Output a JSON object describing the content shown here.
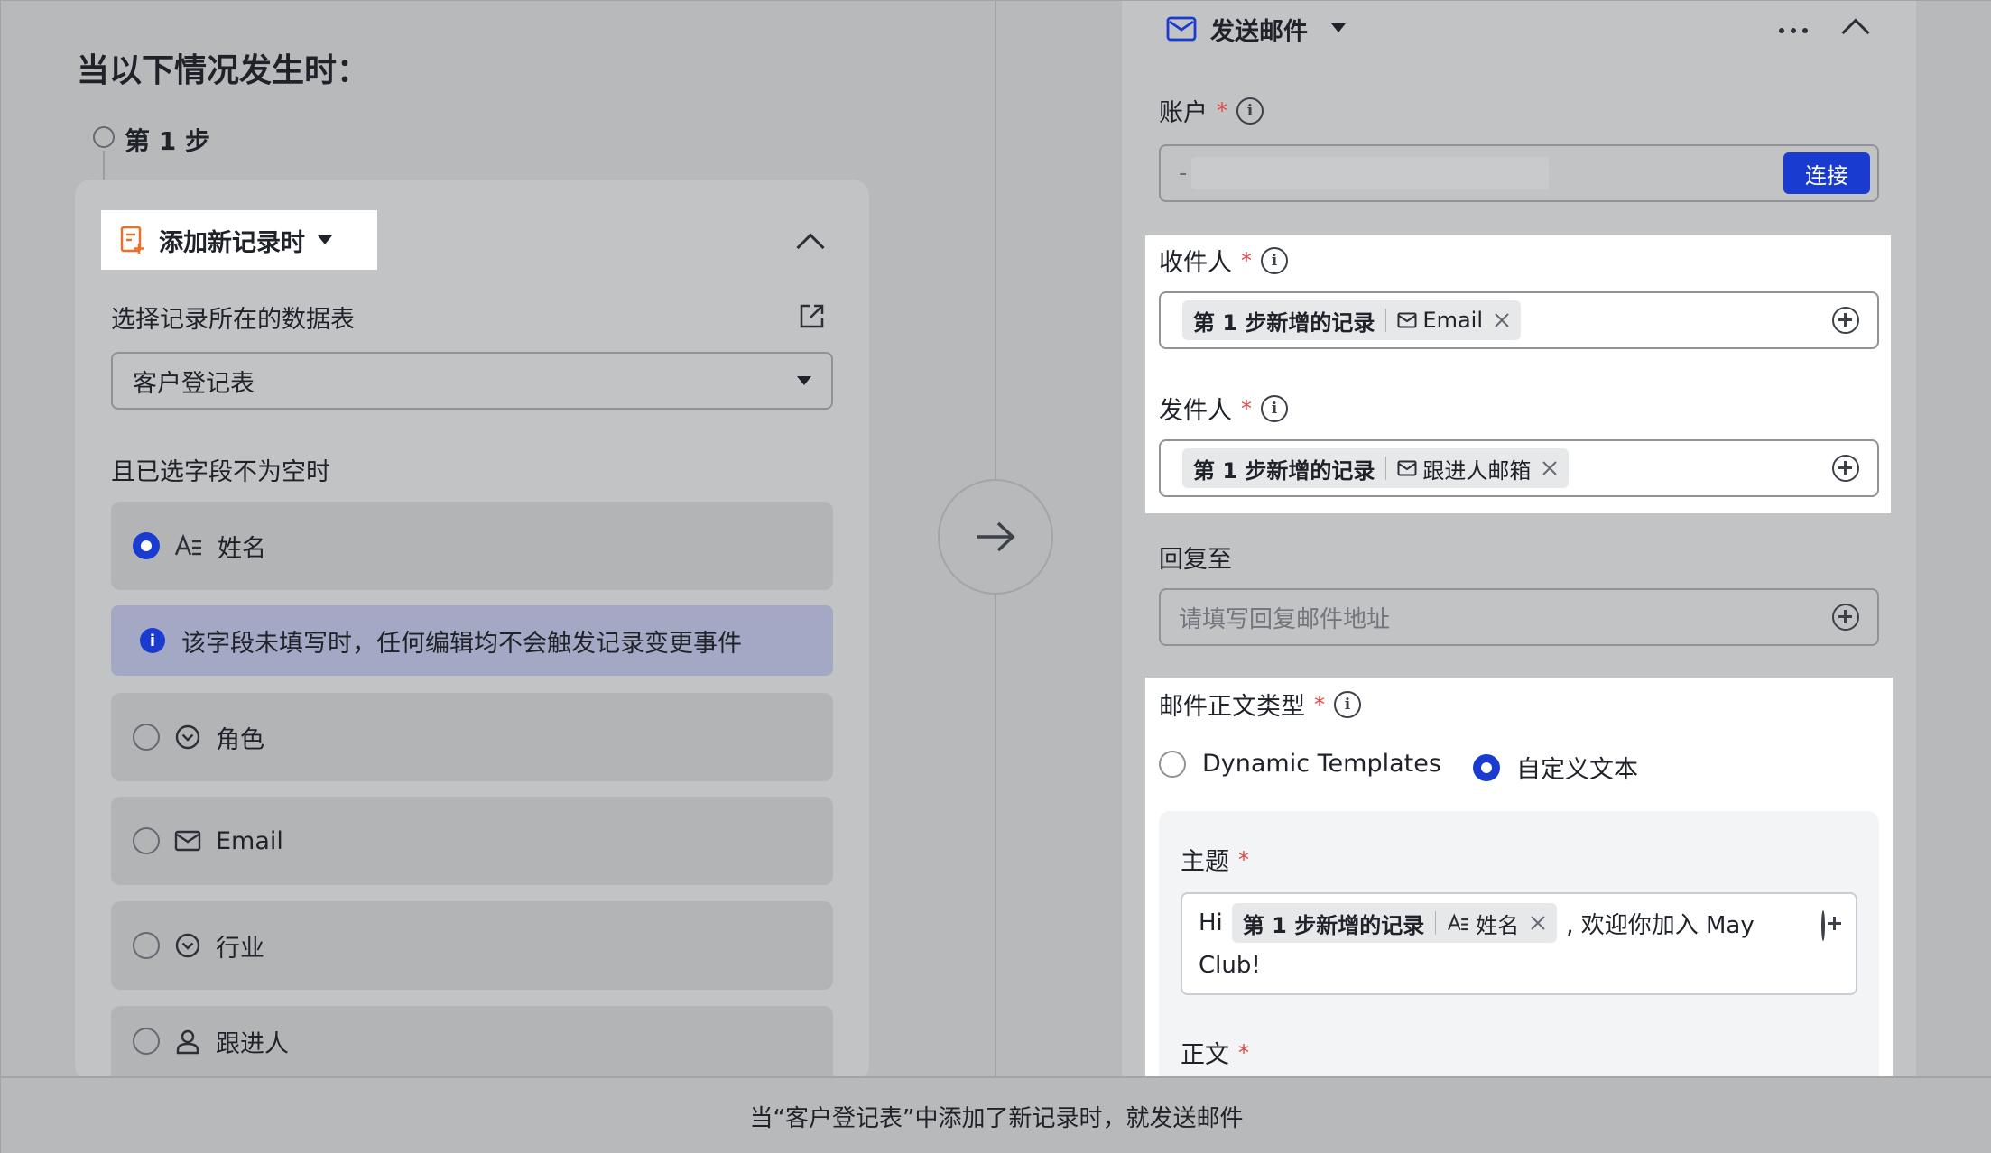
{
  "trigger": {
    "title": "当以下情况发生时：",
    "step_label": "第 1 步",
    "chip_label": "添加新记录时",
    "table_label": "选择记录所在的数据表",
    "table_value": "客户登记表",
    "field_condition_label": "且已选字段不为空时",
    "notice": "该字段未填写时，任何编辑均不会触发记录变更事件",
    "fields": [
      {
        "label": "姓名",
        "selected": true,
        "icon": "text-field-icon"
      },
      {
        "label": "角色",
        "selected": false,
        "icon": "option-field-icon"
      },
      {
        "label": "Email",
        "selected": false,
        "icon": "email-field-icon"
      },
      {
        "label": "行业",
        "selected": false,
        "icon": "option-field-icon"
      },
      {
        "label": "跟进人",
        "selected": false,
        "icon": "person-field-icon"
      }
    ]
  },
  "action": {
    "title": "发送邮件",
    "account_label": "账户",
    "account_value": "-",
    "connect_button": "连接",
    "recipient_label": "收件人",
    "recipient_tag_source": "第 1 步新增的记录",
    "recipient_tag_field": "Email",
    "sender_label": "发件人",
    "sender_tag_source": "第 1 步新增的记录",
    "sender_tag_field": "跟进人邮箱",
    "reply_label": "回复至",
    "reply_placeholder": "请填写回复邮件地址",
    "body_type_label": "邮件正文类型",
    "body_type_options": [
      {
        "label": "Dynamic Templates",
        "selected": false
      },
      {
        "label": "自定义文本",
        "selected": true
      }
    ],
    "subject_label": "主题",
    "subject_prefix": "Hi",
    "subject_tag_source": "第 1 步新增的记录",
    "subject_tag_field": "姓名",
    "subject_suffix": ", 欢迎你加入 May",
    "subject_line2": "Club!",
    "body_label": "正文"
  },
  "caption": "当“客户登记表”中添加了新记录时，就发送邮件",
  "colors": {
    "accent": "#1a3bd0",
    "required": "#e54545",
    "trigger_icon": "#e8702a"
  }
}
